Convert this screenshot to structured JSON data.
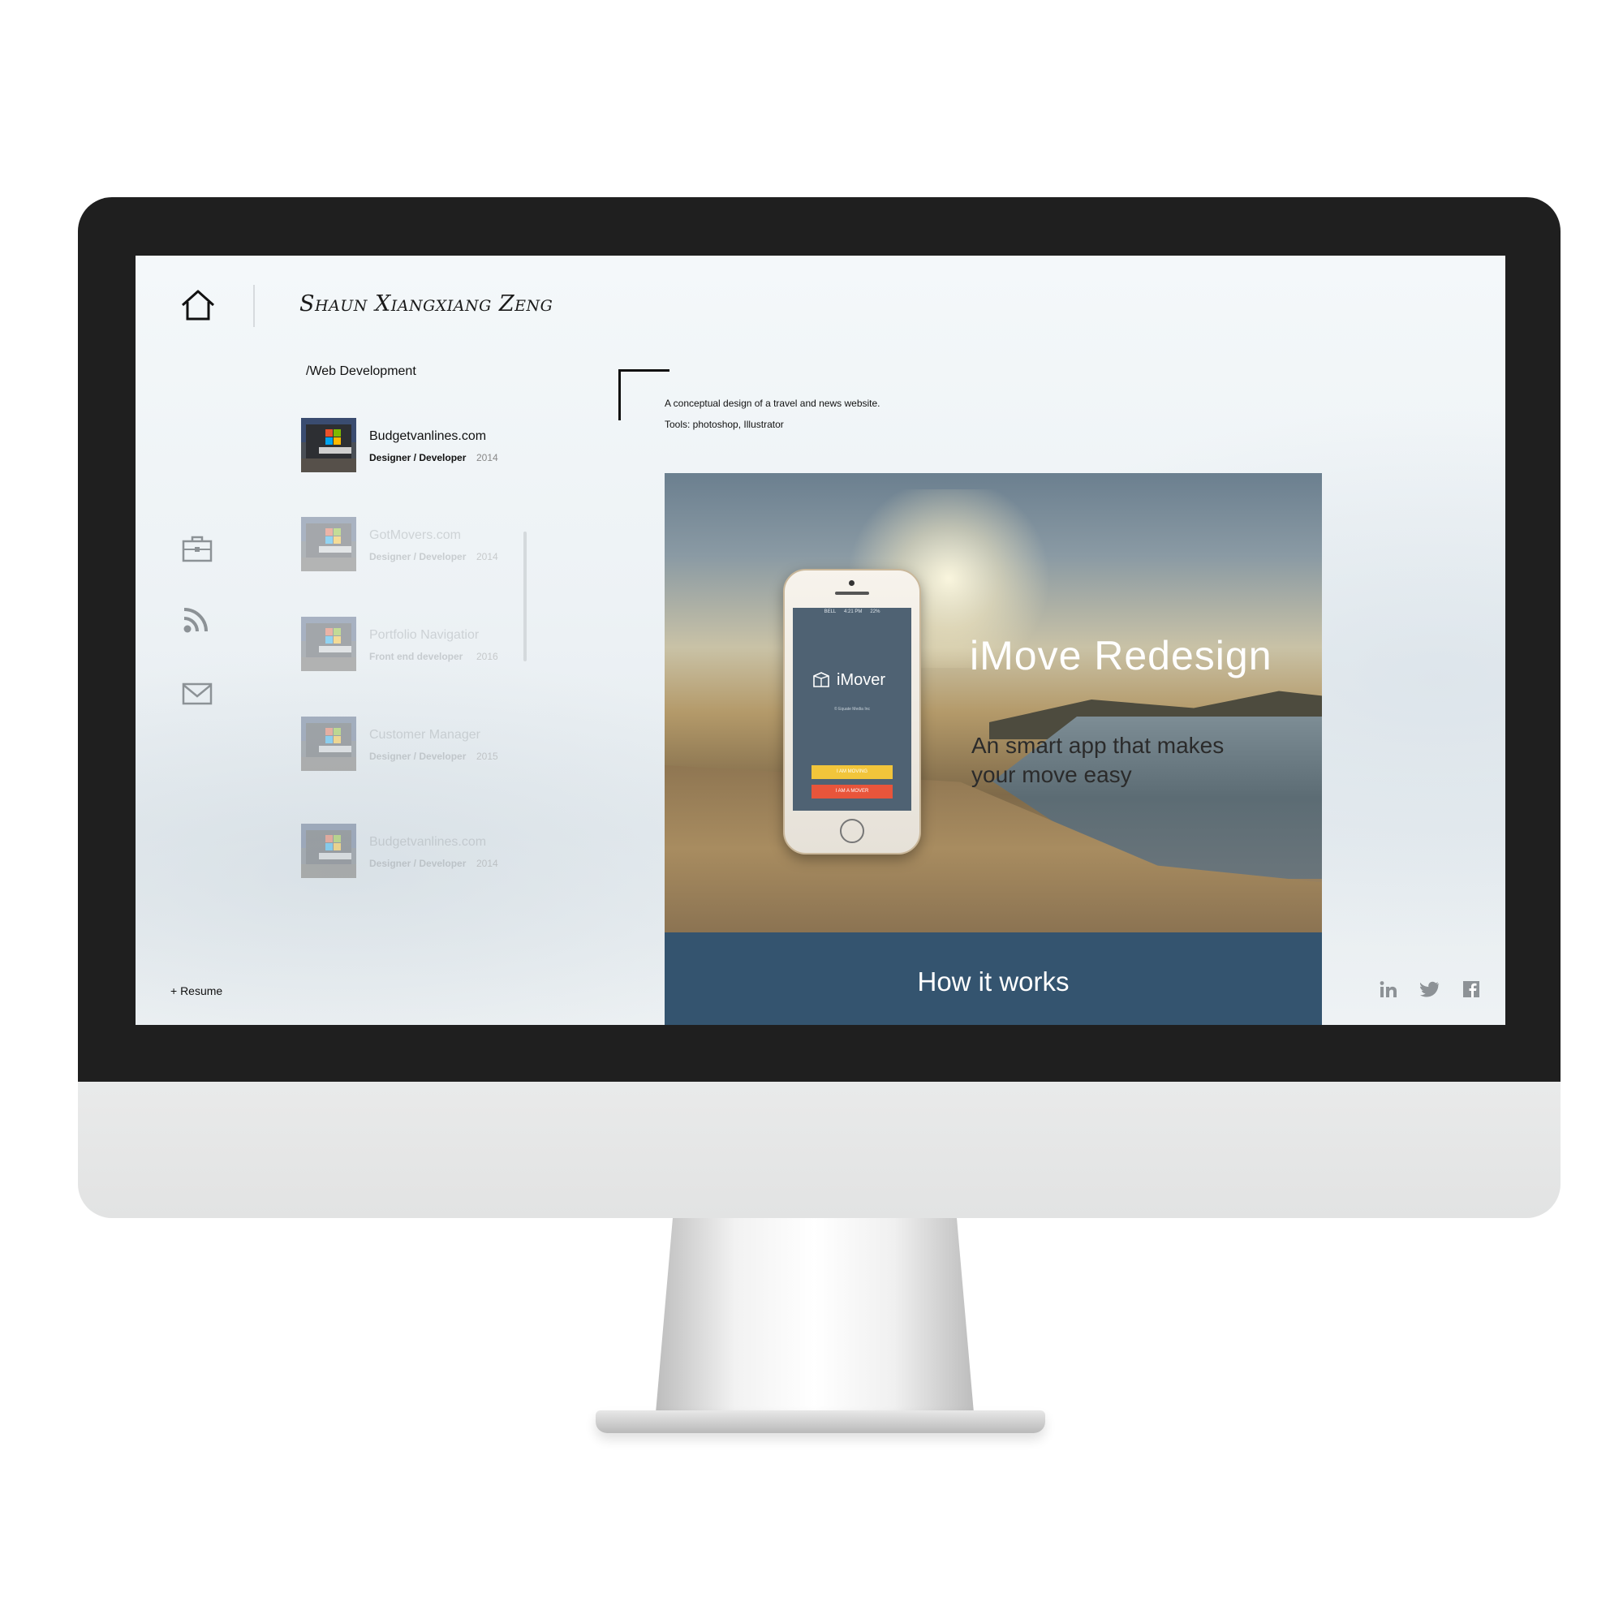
{
  "header": {
    "site_title": "Shaun Xiangxiang Zeng"
  },
  "nav": {
    "icons": [
      "home-icon",
      "briefcase-icon",
      "rss-icon",
      "mail-icon"
    ],
    "resume_link": "+ Resume"
  },
  "sidebar": {
    "section_label": "/Web Development",
    "projects": [
      {
        "name": "Budgetvanlines.com",
        "role": "Designer / Developer",
        "year": "2014",
        "active": true
      },
      {
        "name": "GotMovers.com",
        "role": "Designer / Developer",
        "year": "2014",
        "active": false
      },
      {
        "name": "Portfolio Navigatior",
        "role": "Front end developer",
        "year": "2016",
        "active": false
      },
      {
        "name": "Customer Manager",
        "role": "Designer / Developer",
        "year": "2015",
        "active": false
      },
      {
        "name": "Budgetvanlines.com",
        "role": "Designer / Developer",
        "year": "2014",
        "active": false
      }
    ]
  },
  "project_detail": {
    "description": "A conceptual design of a travel and news website.",
    "tools": "Tools: photoshop, Illustrator"
  },
  "showcase": {
    "phone_app": {
      "status_carrier": "BELL",
      "status_time": "4:21 PM",
      "status_battery": "22%",
      "app_name": "iMover",
      "app_copyright": "© Equate Media Inc",
      "btn_moving": "I AM MOVING",
      "btn_mover": "I AM A MOVER"
    },
    "hero_title": "iMove Redesign",
    "hero_subtitle": "An smart app that makes your move easy",
    "section_heading": "How it works",
    "section_bar_color": "#34546f"
  },
  "social": {
    "icons": [
      "linkedin-icon",
      "twitter-icon",
      "facebook-icon"
    ]
  }
}
